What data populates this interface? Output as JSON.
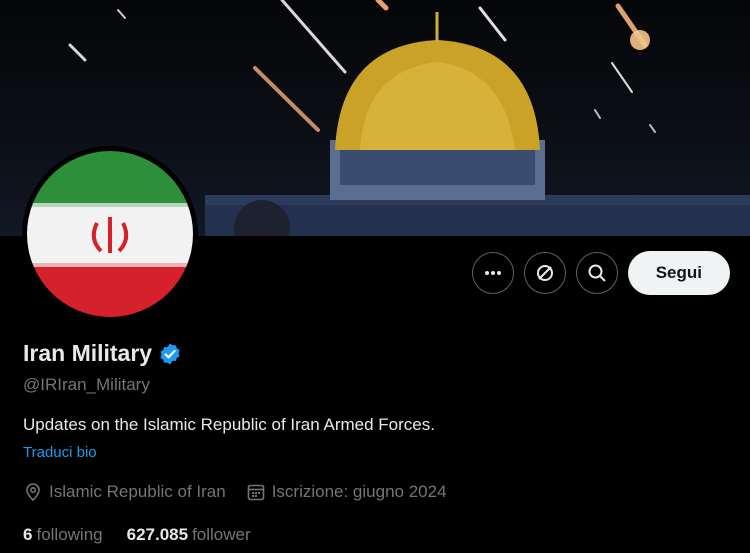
{
  "profile": {
    "display_name": "Iran Military",
    "handle": "@IRIran_Military",
    "bio": "Updates on the Islamic Republic of Iran Armed Forces.",
    "translate_label": "Traduci bio",
    "location": "Islamic Republic of Iran",
    "joined": "Iscrizione: giugno 2024"
  },
  "actions": {
    "more_icon": "more-icon",
    "subscribe_icon": "sync-icon",
    "search_icon": "search-icon",
    "follow_label": "Segui"
  },
  "stats": {
    "following_count": "6",
    "following_label": "following",
    "followers_count": "627.085",
    "followers_label": "follower"
  },
  "colors": {
    "background": "#000000",
    "text": "#e7e9ea",
    "muted": "#71767b",
    "link": "#1d9bf0",
    "verified": "#1d9bf0",
    "follow_button": "#eff3f4"
  }
}
